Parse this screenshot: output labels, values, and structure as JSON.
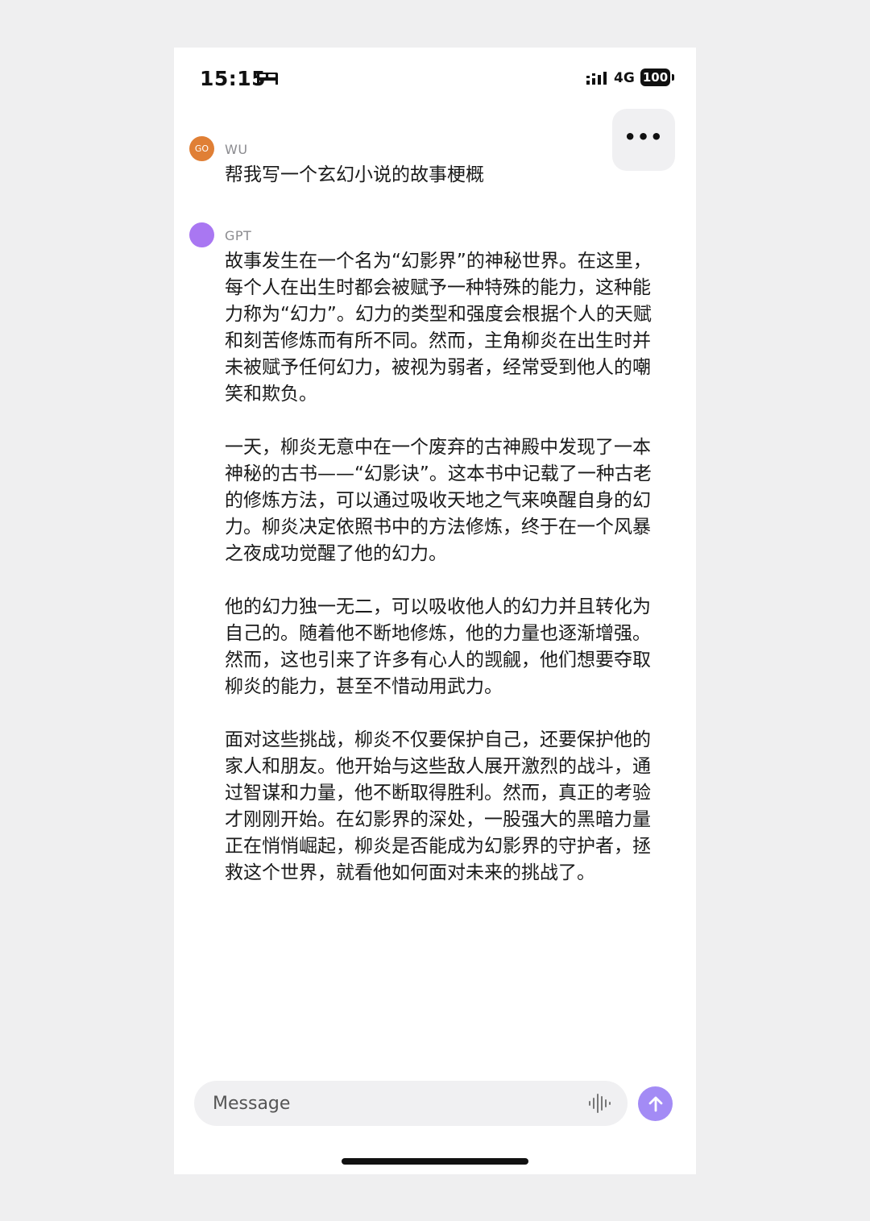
{
  "status_bar": {
    "time": "15:15",
    "network": "4G",
    "battery": "100",
    "icons": [
      "bed-icon",
      "signal-icon"
    ]
  },
  "header": {
    "more_label": "•••"
  },
  "messages": [
    {
      "sender": "WU",
      "avatar_text": "GO",
      "avatar_color": "#e07f35",
      "text": "帮我写一个玄幻小说的故事梗概"
    },
    {
      "sender": "GPT",
      "avatar_color": "#a977f2",
      "paragraphs": [
        "故事发生在一个名为“幻影界”的神秘世界。在这里，每个人在出生时都会被赋予一种特殊的能力，这种能力称为“幻力”。幻力的类型和强度会根据个人的天赋和刻苦修炼而有所不同。然而，主角柳炎在出生时并未被赋予任何幻力，被视为弱者，经常受到他人的嘲笑和欺负。",
        "一天，柳炎无意中在一个废弃的古神殿中发现了一本神秘的古书——“幻影诀”。这本书中记载了一种古老的修炼方法，可以通过吸收天地之气来唤醒自身的幻力。柳炎决定依照书中的方法修炼，终于在一个风暴之夜成功觉醒了他的幻力。",
        "他的幻力独一无二，可以吸收他人的幻力并且转化为自己的。随着他不断地修炼，他的力量也逐渐增强。然而，这也引来了许多有心人的觊觎，他们想要夺取柳炎的能力，甚至不惜动用武力。",
        "面对这些挑战，柳炎不仅要保护自己，还要保护他的家人和朋友。他开始与这些敌人展开激烈的战斗，通过智谋和力量，他不断取得胜利。然而，真正的考验才刚刚开始。在幻影界的深处，一股强大的黑暗力量正在悄悄崛起，柳炎是否能成为幻影界的守护者，拯救这个世界，就看他如何面对未来的挑战了。"
      ]
    }
  ],
  "composer": {
    "placeholder": "Message",
    "send_color": "#a38bf5"
  }
}
